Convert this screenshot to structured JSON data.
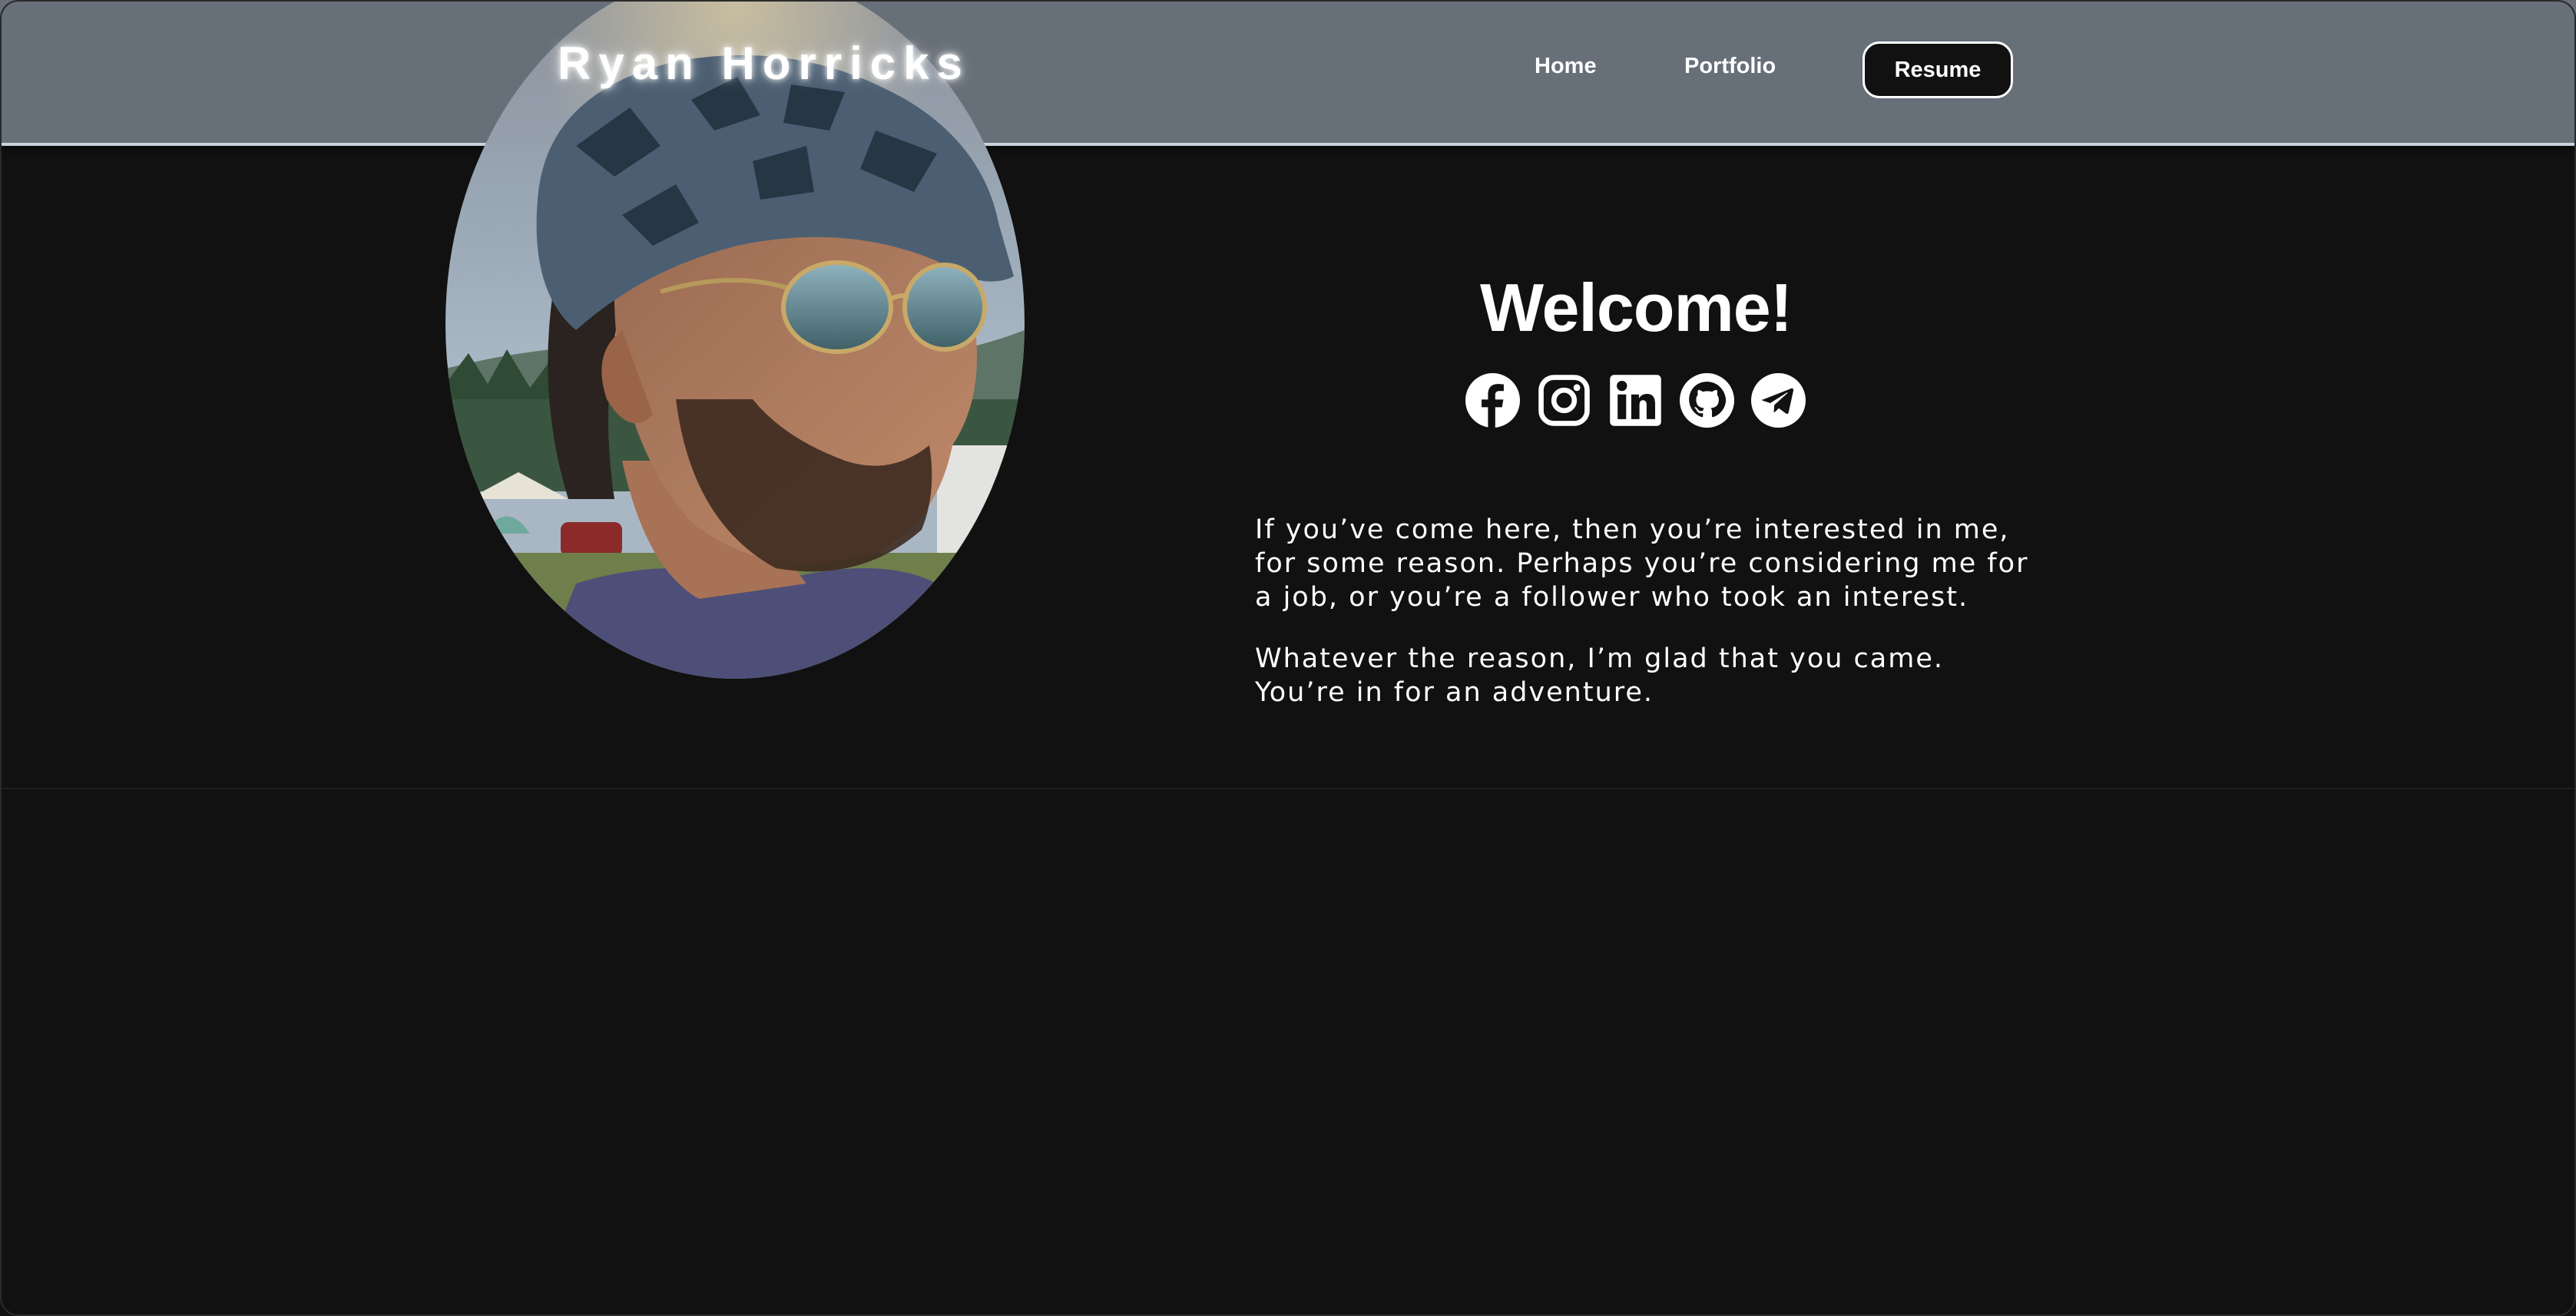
{
  "header": {
    "site_title": "Ryan Horricks",
    "nav": {
      "home": "Home",
      "portfolio": "Portfolio",
      "resume": "Resume"
    }
  },
  "hero": {
    "heading": "Welcome!",
    "portrait_alt": "portrait of Ryan Horricks wearing a bucket hat and sunglasses",
    "social_icons": [
      "facebook-icon",
      "instagram-icon",
      "linkedin-icon",
      "github-icon",
      "telegram-icon"
    ],
    "paragraphs": [
      "If you’ve come here, then you’re interested in me, for some reason. Perhaps you’re considering me for a job, or you’re a follower who took an interest.",
      "Whatever the reason, I’m glad that you came. You’re in for an adventure."
    ]
  },
  "colors": {
    "header_bg": "#676f79",
    "page_bg": "#111111",
    "text": "#ffffff"
  }
}
